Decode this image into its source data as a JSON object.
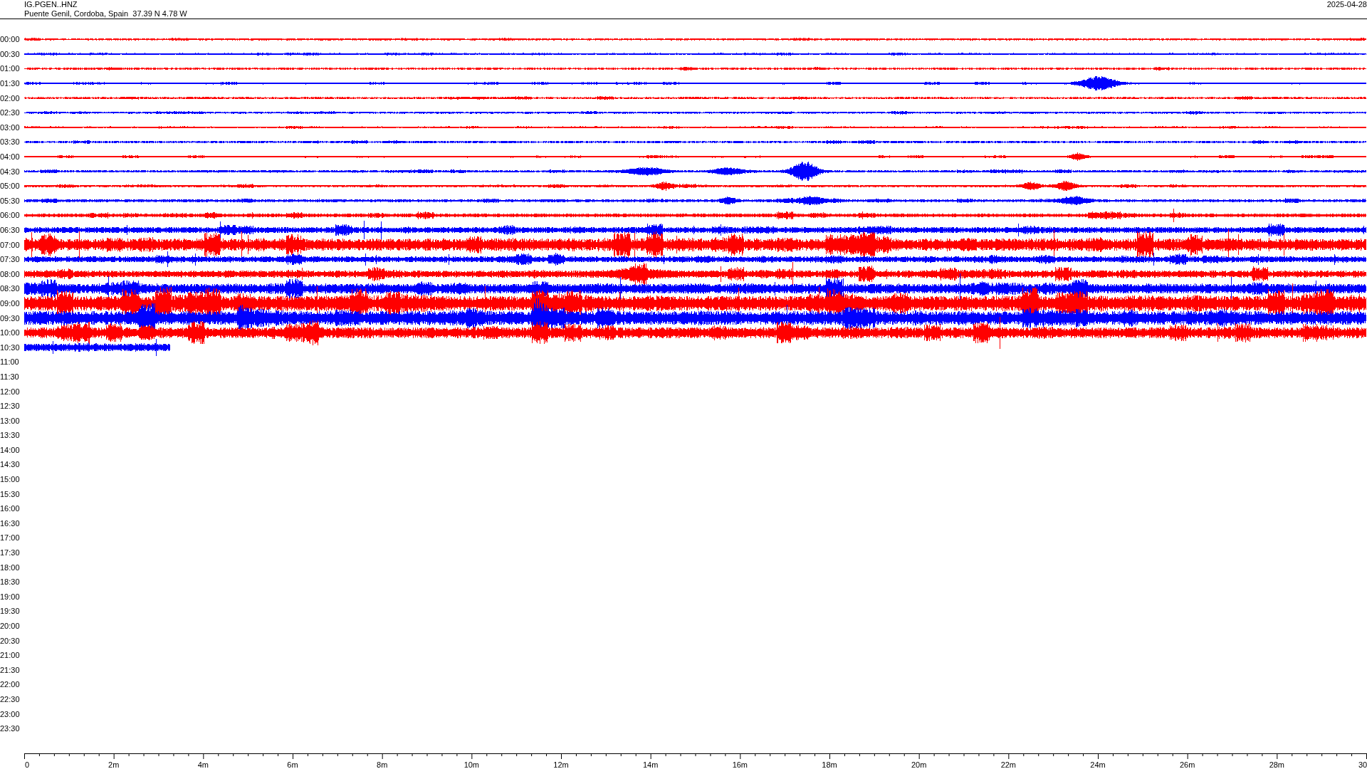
{
  "header": {
    "station": "IG.PGEN..HNZ",
    "location": "Puente Genil, Cordoba, Spain  37.39 N 4.78 W",
    "date": "2025-04-28"
  },
  "rows": [
    {
      "label": "00:00",
      "color": "#ff0000"
    },
    {
      "label": "00:30",
      "color": "#0000ff"
    },
    {
      "label": "01:00",
      "color": "#ff0000"
    },
    {
      "label": "01:30",
      "color": "#0000ff"
    },
    {
      "label": "02:00",
      "color": "#ff0000"
    },
    {
      "label": "02:30",
      "color": "#0000ff"
    },
    {
      "label": "03:00",
      "color": "#ff0000"
    },
    {
      "label": "03:30",
      "color": "#0000ff"
    },
    {
      "label": "04:00",
      "color": "#ff0000"
    },
    {
      "label": "04:30",
      "color": "#0000ff"
    },
    {
      "label": "05:00",
      "color": "#ff0000"
    },
    {
      "label": "05:30",
      "color": "#0000ff"
    },
    {
      "label": "06:00",
      "color": "#ff0000"
    },
    {
      "label": "06:30",
      "color": "#0000ff"
    },
    {
      "label": "07:00",
      "color": "#ff0000"
    },
    {
      "label": "07:30",
      "color": "#0000ff"
    },
    {
      "label": "08:00",
      "color": "#ff0000"
    },
    {
      "label": "08:30",
      "color": "#0000ff"
    },
    {
      "label": "09:00",
      "color": "#ff0000"
    },
    {
      "label": "09:30",
      "color": "#0000ff"
    },
    {
      "label": "10:00",
      "color": "#ff0000"
    },
    {
      "label": "10:30",
      "color": "#0000ff"
    },
    {
      "label": "11:00"
    },
    {
      "label": "11:30"
    },
    {
      "label": "12:00"
    },
    {
      "label": "12:30"
    },
    {
      "label": "13:00"
    },
    {
      "label": "13:30"
    },
    {
      "label": "14:00"
    },
    {
      "label": "14:30"
    },
    {
      "label": "15:00"
    },
    {
      "label": "15:30"
    },
    {
      "label": "16:00"
    },
    {
      "label": "16:30"
    },
    {
      "label": "17:00"
    },
    {
      "label": "17:30"
    },
    {
      "label": "18:00"
    },
    {
      "label": "18:30"
    },
    {
      "label": "19:00"
    },
    {
      "label": "19:30"
    },
    {
      "label": "20:00"
    },
    {
      "label": "20:30"
    },
    {
      "label": "21:00"
    },
    {
      "label": "21:30"
    },
    {
      "label": "22:00"
    },
    {
      "label": "22:30"
    },
    {
      "label": "23:00"
    },
    {
      "label": "23:30"
    }
  ],
  "axis": {
    "ticks": [
      "0",
      "2m",
      "4m",
      "6m",
      "8m",
      "10m",
      "12m",
      "14m",
      "16m",
      "18m",
      "20m",
      "22m",
      "24m",
      "26m",
      "28m",
      "30"
    ]
  }
}
